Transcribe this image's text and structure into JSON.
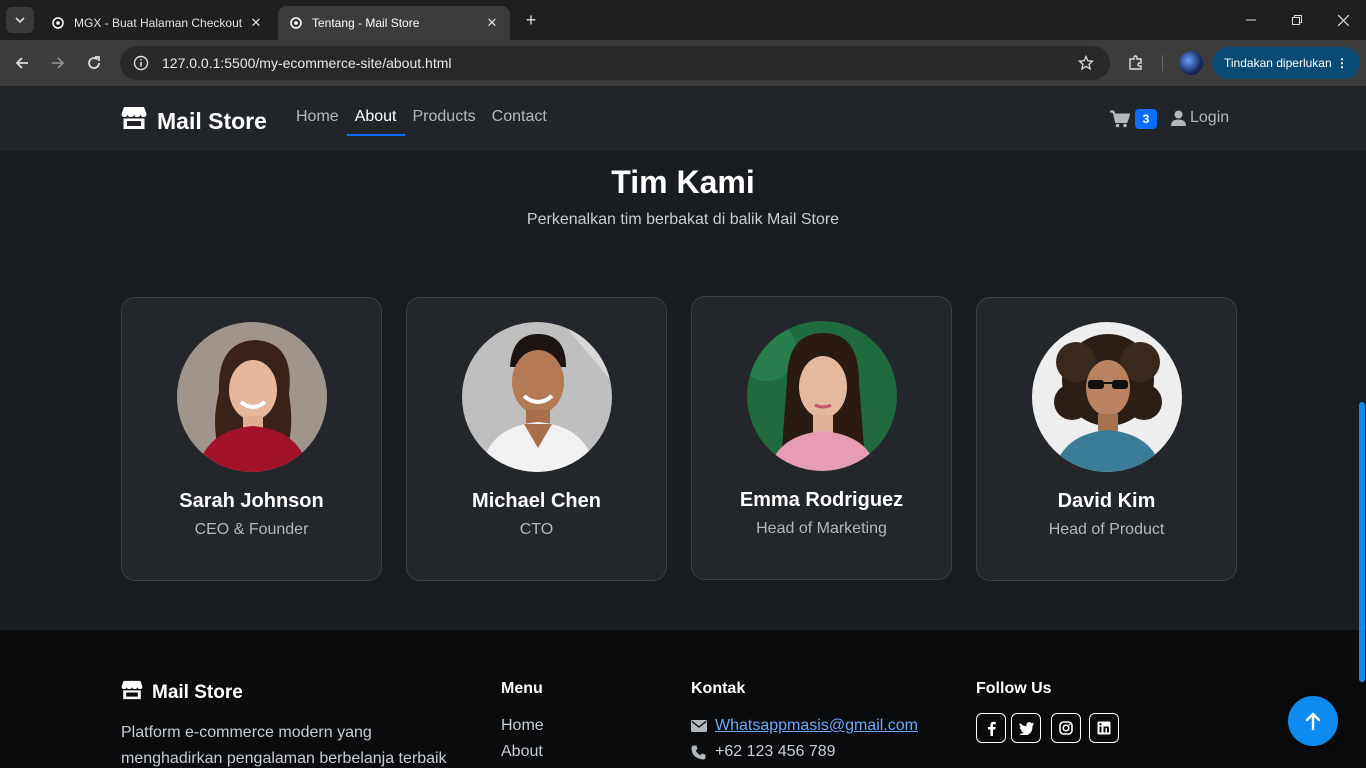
{
  "browser": {
    "tabs": [
      {
        "title": "MGX - Buat Halaman Checkout",
        "active": false
      },
      {
        "title": "Tentang - Mail Store",
        "active": true
      }
    ],
    "url": "127.0.0.1:5500/my-ecommerce-site/about.html",
    "action_label": "Tindakan diperlukan"
  },
  "navbar": {
    "brand": "Mail Store",
    "links": [
      "Home",
      "About",
      "Products",
      "Contact"
    ],
    "active_link": "About",
    "cart_count": "3",
    "login_label": "Login",
    "accent_color": "#0d6efd"
  },
  "team": {
    "title": "Tim Kami",
    "subtitle": "Perkenalkan tim berbakat di balik Mail Store",
    "members": [
      {
        "name": "Sarah Johnson",
        "role": "CEO & Founder"
      },
      {
        "name": "Michael Chen",
        "role": "CTO"
      },
      {
        "name": "Emma Rodriguez",
        "role": "Head of Marketing"
      },
      {
        "name": "David Kim",
        "role": "Head of Product"
      }
    ]
  },
  "footer": {
    "brand": "Mail Store",
    "description": "Platform e-commerce modern yang menghadirkan pengalaman berbelanja terbaik",
    "menu_title": "Menu",
    "menu_links": [
      "Home",
      "About"
    ],
    "contact_title": "Kontak",
    "email": "Whatsappmasis@gmail.com",
    "phone": "+62 123 456 789",
    "follow_title": "Follow Us",
    "socials": [
      "facebook-icon",
      "twitter-icon",
      "instagram-icon",
      "linkedin-icon"
    ]
  }
}
